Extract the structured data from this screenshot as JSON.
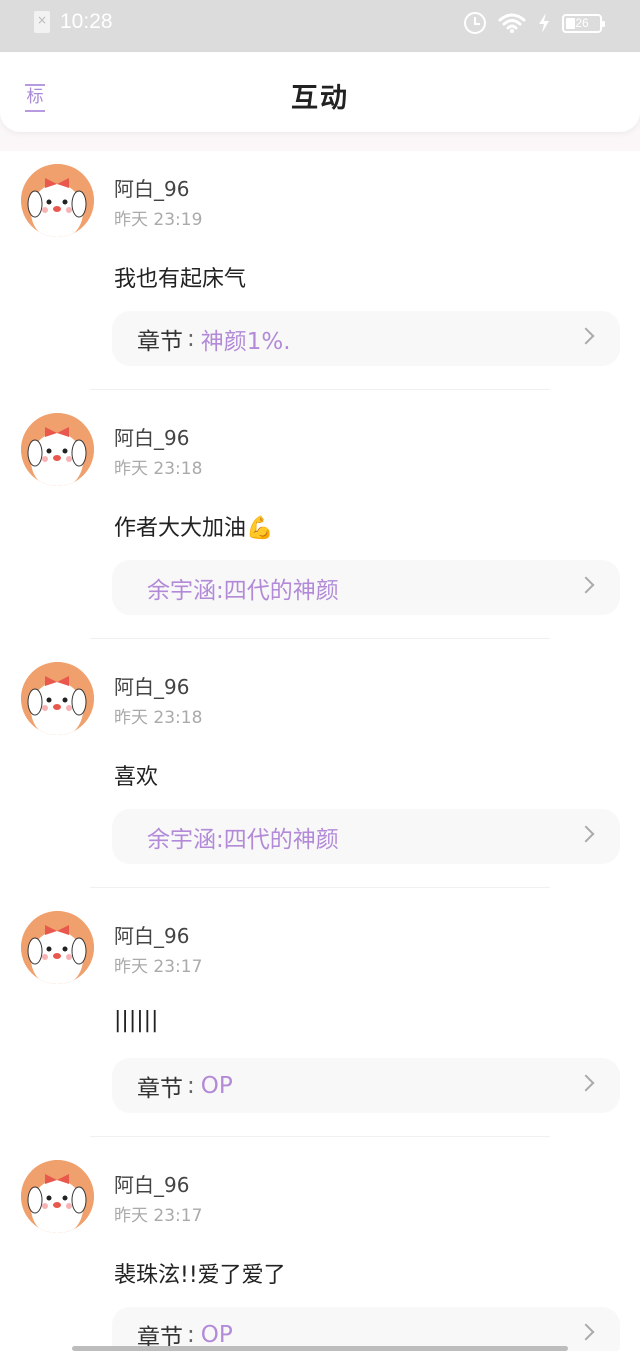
{
  "status_bar": {
    "time": "10:28",
    "battery": "26"
  },
  "header": {
    "title": "互动",
    "left_label": "标"
  },
  "items": [
    {
      "username": "阿白_96",
      "time": "昨天 23:19",
      "comment": "我也有起床气",
      "chapter_prefix": "章节",
      "chapter_colon": ":",
      "chapter_name": "神颜1%."
    },
    {
      "username": "阿白_96",
      "time": "昨天 23:18",
      "comment": "作者大大加油💪",
      "chapter_prefix": "",
      "chapter_colon": "",
      "chapter_name": "余宇涵:四代的神颜"
    },
    {
      "username": "阿白_96",
      "time": "昨天 23:18",
      "comment": "喜欢",
      "chapter_prefix": "",
      "chapter_colon": "",
      "chapter_name": "余宇涵:四代的神颜"
    },
    {
      "username": "阿白_96",
      "time": "昨天 23:17",
      "comment": "||||||",
      "chapter_prefix": "章节",
      "chapter_colon": ":",
      "chapter_name": "OP"
    },
    {
      "username": "阿白_96",
      "time": "昨天 23:17",
      "comment": "裴珠泫!!爱了爱了",
      "chapter_prefix": "章节",
      "chapter_colon": ":",
      "chapter_name": "OP"
    }
  ],
  "icons": [
    "sim-icon",
    "alarm-icon",
    "wifi-icon",
    "bolt-icon",
    "battery-icon",
    "mark-icon",
    "chevron-right-icon",
    "avatar"
  ],
  "colors": {
    "accent": "#b28ad8",
    "avatar_bg": "#f0a06c"
  }
}
